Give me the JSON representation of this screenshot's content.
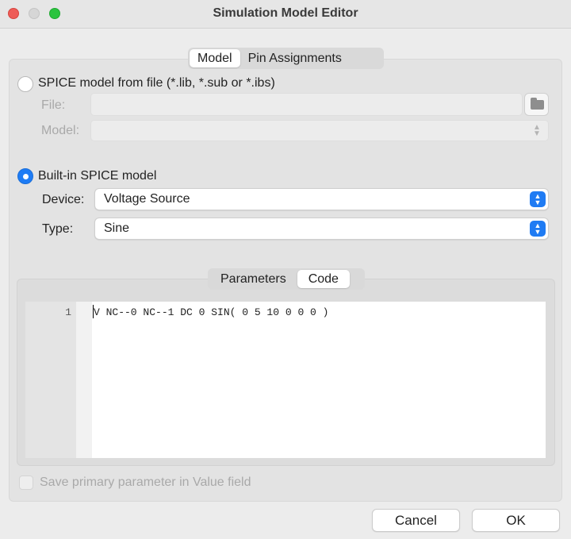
{
  "window": {
    "title": "Simulation Model Editor"
  },
  "main_tabs": [
    {
      "label": "Model",
      "active": true
    },
    {
      "label": "Pin Assignments",
      "active": false
    }
  ],
  "spice_from_file": {
    "radio_label": "SPICE model from file (*.lib, *.sub or *.ibs)",
    "selected": false,
    "file_label": "File:",
    "file_value": "",
    "model_label": "Model:",
    "model_value": ""
  },
  "builtin": {
    "radio_label": "Built-in SPICE model",
    "selected": true,
    "device_label": "Device:",
    "device_value": "Voltage Source",
    "type_label": "Type:",
    "type_value": "Sine"
  },
  "sub_tabs": [
    {
      "label": "Parameters",
      "active": false
    },
    {
      "label": "Code",
      "active": true
    }
  ],
  "code_editor": {
    "lines": [
      {
        "number": "1",
        "text": "V NC--0 NC--1 DC 0 SIN( 0 5 10 0 0 0 )"
      }
    ]
  },
  "save_primary": {
    "label": "Save primary parameter in Value field",
    "checked": false,
    "enabled": false
  },
  "buttons": {
    "cancel": "Cancel",
    "ok": "OK"
  },
  "colors": {
    "accent": "#1e7cf5",
    "window_bg": "#ececec"
  },
  "icons": {
    "folder": "folder-icon",
    "stepper": "chevron-updown-icon"
  }
}
